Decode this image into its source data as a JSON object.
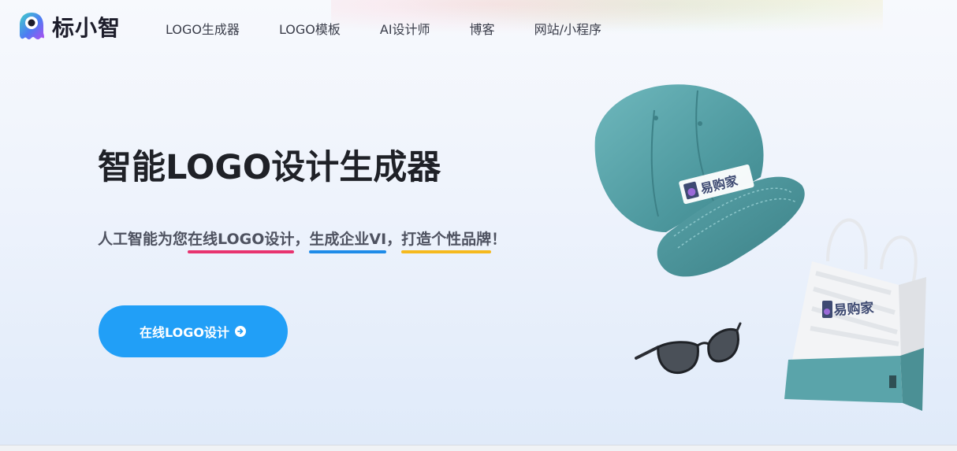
{
  "brand": {
    "name": "标小智"
  },
  "nav": {
    "items": [
      {
        "label": "LOGO生成器"
      },
      {
        "label": "LOGO模板"
      },
      {
        "label": "AI设计师"
      },
      {
        "label": "博客"
      },
      {
        "label": "网站/小程序"
      }
    ]
  },
  "hero": {
    "title": "智能LOGO设计生成器",
    "subtitle_parts": [
      "人工智能为您",
      "在线LOGO设计",
      "，",
      "生成企业VI",
      "，",
      "打造个性品牌",
      "！"
    ],
    "cta_label": "在线LOGO设计"
  },
  "products": {
    "cap_brand": "易购家",
    "bag_brand": "易购家"
  },
  "colors": {
    "accent": "#219ff7",
    "underline_pink": "#e8336f",
    "underline_blue": "#1e8be8",
    "underline_yellow": "#f5b91e",
    "cap": "#5fa8ad"
  },
  "icons": {
    "cta_icon": "arrow-right-circle-icon",
    "logo_icon": "ghost-mascot-icon"
  }
}
